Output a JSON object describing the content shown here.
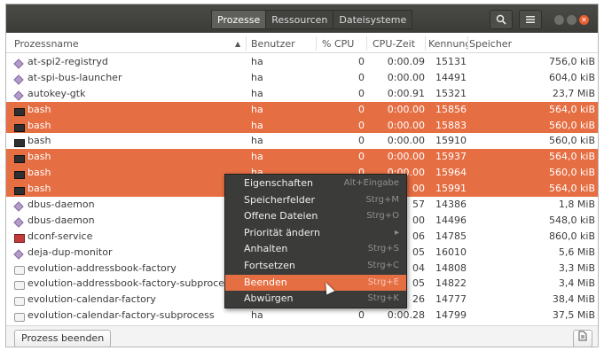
{
  "tabs": [
    "Prozesse",
    "Ressourcen",
    "Dateisysteme"
  ],
  "columns": {
    "name": "Prozessname",
    "user": "Benutzer",
    "cpu": "% CPU",
    "time": "CPU-Zeit",
    "pid": "Kennung",
    "mem": "Speicher"
  },
  "rows": [
    {
      "icon": "app-icon",
      "name": "at-spi2-registryd",
      "user": "ha",
      "cpu": "0",
      "time": "0:00.09",
      "pid": "15131",
      "mem": "756,0 kiB",
      "selected": false
    },
    {
      "icon": "app-icon",
      "name": "at-spi-bus-launcher",
      "user": "ha",
      "cpu": "0",
      "time": "0:00.00",
      "pid": "14491",
      "mem": "604,0 kiB",
      "selected": false
    },
    {
      "icon": "app-icon",
      "name": "autokey-gtk",
      "user": "ha",
      "cpu": "0",
      "time": "0:00.91",
      "pid": "15321",
      "mem": "23,7 MiB",
      "selected": false
    },
    {
      "icon": "terminal-icon",
      "name": "bash",
      "user": "ha",
      "cpu": "0",
      "time": "0:00.00",
      "pid": "15856",
      "mem": "564,0 kiB",
      "selected": true
    },
    {
      "icon": "terminal-icon",
      "name": "bash",
      "user": "ha",
      "cpu": "0",
      "time": "0:00.00",
      "pid": "15883",
      "mem": "560,0 kiB",
      "selected": true
    },
    {
      "icon": "terminal-icon",
      "name": "bash",
      "user": "ha",
      "cpu": "0",
      "time": "0:00.00",
      "pid": "15910",
      "mem": "560,0 kiB",
      "selected": false
    },
    {
      "icon": "terminal-icon",
      "name": "bash",
      "user": "ha",
      "cpu": "0",
      "time": "0:00.00",
      "pid": "15937",
      "mem": "564,0 kiB",
      "selected": true
    },
    {
      "icon": "terminal-icon",
      "name": "bash",
      "user": "ha",
      "cpu": "0",
      "time": "0:00.00",
      "pid": "15964",
      "mem": "560,0 kiB",
      "selected": true
    },
    {
      "icon": "terminal-icon",
      "name": "bash",
      "user": "",
      "cpu": "",
      "time": "00",
      "pid": "15991",
      "mem": "564,0 kiB",
      "selected": true
    },
    {
      "icon": "app-icon",
      "name": "dbus-daemon",
      "user": "",
      "cpu": "",
      "time": "57",
      "pid": "14386",
      "mem": "1,8 MiB",
      "selected": false
    },
    {
      "icon": "app-icon",
      "name": "dbus-daemon",
      "user": "",
      "cpu": "",
      "time": "00",
      "pid": "14496",
      "mem": "548,0 kiB",
      "selected": false
    },
    {
      "icon": "dconf-icon",
      "name": "dconf-service",
      "user": "",
      "cpu": "",
      "time": "06",
      "pid": "14785",
      "mem": "860,0 kiB",
      "selected": false
    },
    {
      "icon": "app-icon",
      "name": "deja-dup-monitor",
      "user": "",
      "cpu": "",
      "time": "05",
      "pid": "16010",
      "mem": "5,6 MiB",
      "selected": false
    },
    {
      "icon": "file-icon",
      "name": "evolution-addressbook-factory",
      "user": "",
      "cpu": "",
      "time": "04",
      "pid": "14808",
      "mem": "3,3 MiB",
      "selected": false
    },
    {
      "icon": "file-icon",
      "name": "evolution-addressbook-factory-subproces",
      "user": "",
      "cpu": "",
      "time": "05",
      "pid": "14822",
      "mem": "3,4 MiB",
      "selected": false
    },
    {
      "icon": "file-icon",
      "name": "evolution-calendar-factory",
      "user": "",
      "cpu": "",
      "time": "26",
      "pid": "14777",
      "mem": "38,4 MiB",
      "selected": false
    },
    {
      "icon": "file-icon",
      "name": "evolution-calendar-factory-subprocess",
      "user": "ha",
      "cpu": "0",
      "time": "0:00.28",
      "pid": "14799",
      "mem": "37,5 MiB",
      "selected": false
    }
  ],
  "context_menu": [
    {
      "label": "Eigenschaften",
      "shortcut": "Alt+Eingabe",
      "highlighted": false
    },
    {
      "label": "Speicherfelder",
      "shortcut": "Strg+M",
      "highlighted": false
    },
    {
      "label": "Offene Dateien",
      "shortcut": "Strg+O",
      "highlighted": false
    },
    {
      "label": "Priorität ändern",
      "shortcut": "▸",
      "highlighted": false
    },
    {
      "label": "Anhalten",
      "shortcut": "Strg+S",
      "highlighted": false
    },
    {
      "label": "Fortsetzen",
      "shortcut": "Strg+C",
      "highlighted": false
    },
    {
      "label": "Beenden",
      "shortcut": "Strg+E",
      "highlighted": true
    },
    {
      "label": "Abwürgen",
      "shortcut": "Strg+K",
      "highlighted": false
    }
  ],
  "footer": {
    "end_process": "Prozess beenden"
  },
  "colors": {
    "accent": "#e66e43",
    "titlebar": "#3b3b38"
  }
}
